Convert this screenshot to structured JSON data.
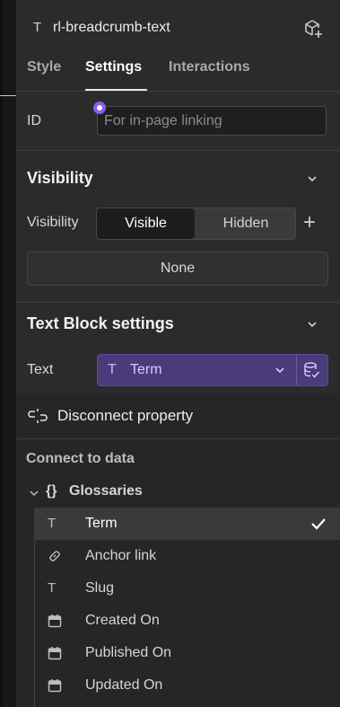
{
  "header": {
    "type_glyph": "T",
    "title": "rl-breadcrumb-text",
    "cube_icon": "component-cube-plus-icon"
  },
  "tabs": [
    {
      "label": "Style",
      "active": false
    },
    {
      "label": "Settings",
      "active": true
    },
    {
      "label": "Interactions",
      "active": false
    }
  ],
  "id_field": {
    "label": "ID",
    "placeholder": "For in-page linking",
    "value": ""
  },
  "visibility": {
    "section_title": "Visibility",
    "label": "Visibility",
    "options": [
      "Visible",
      "Hidden"
    ],
    "selected": "Visible",
    "condition": "None"
  },
  "text_block": {
    "section_title": "Text Block settings",
    "label": "Text",
    "bound_glyph": "T",
    "bound_value": "Term"
  },
  "dropdown": {
    "disconnect_label": "Disconnect property",
    "connect_heading": "Connect to data",
    "group": {
      "braces": "{}",
      "label": "Glossaries"
    },
    "items": [
      {
        "label": "Term",
        "icon": "text-icon",
        "selected": true
      },
      {
        "label": "Anchor link",
        "icon": "link-icon",
        "selected": false
      },
      {
        "label": "Slug",
        "icon": "text-icon",
        "selected": false
      },
      {
        "label": "Created On",
        "icon": "calendar-icon",
        "selected": false
      },
      {
        "label": "Published On",
        "icon": "calendar-icon",
        "selected": false
      },
      {
        "label": "Updated On",
        "icon": "calendar-icon",
        "selected": false
      }
    ]
  },
  "colors": {
    "panel_bg": "#2b2b2b",
    "accent": "#8b5cf6",
    "bound_bg": "#4a3b7a",
    "bound_text": "#d8ccff"
  }
}
